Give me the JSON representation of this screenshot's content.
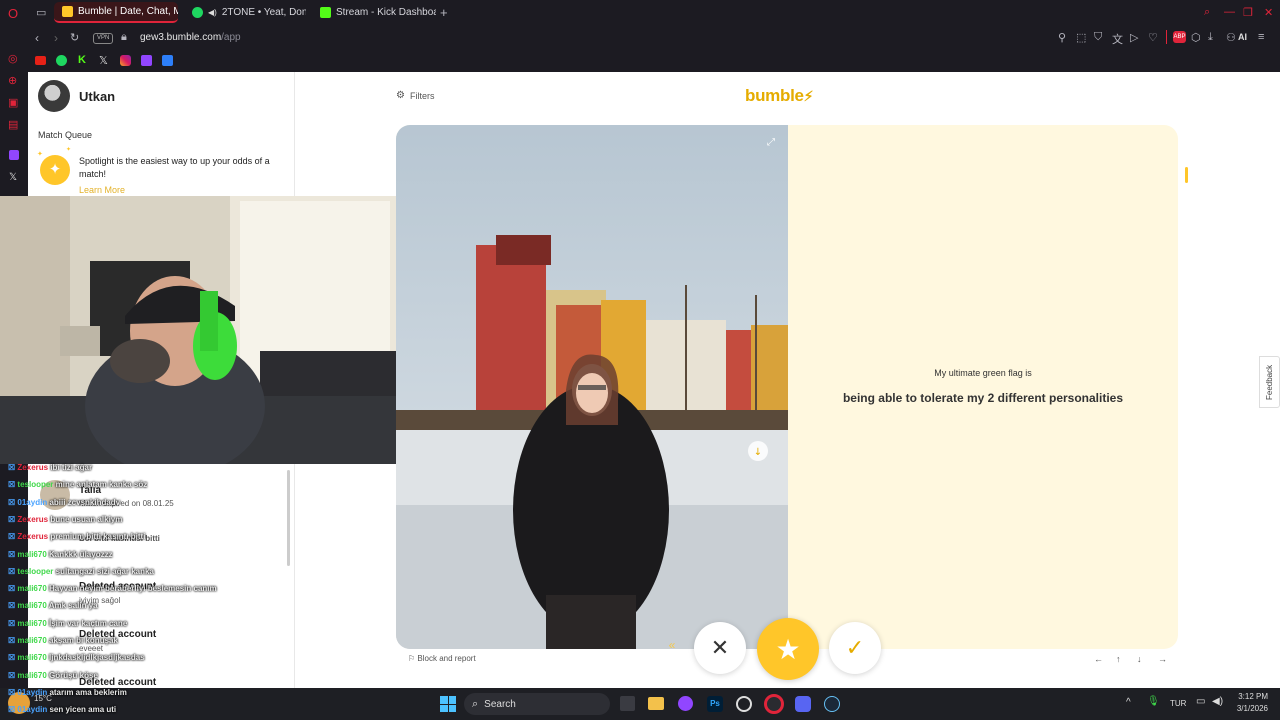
{
  "browser": {
    "tabs": [
      {
        "label": "Bumble | Date, Chat, Meet",
        "color": "#ffc629"
      },
      {
        "label": "2TONE • Yeat, Don To",
        "color": "#1ed760"
      },
      {
        "label": "Stream - Kick Dashboard",
        "color": "#53fc18"
      }
    ],
    "add_tab": "+",
    "vpn_badge": "VPN",
    "url_domain": "gew3.bumble.com",
    "url_path": "/app",
    "ai_label": "AI"
  },
  "profile": {
    "name": "Utkan"
  },
  "match_queue": {
    "heading": "Match Queue",
    "spotlight_text": "Spotlight is the easiest way to up your odds of a match!",
    "learn_more": "Learn More"
  },
  "conversations": [
    {
      "name": "Talia",
      "sub": "Match expired on 08.01.25"
    },
    {
      "name": "",
      "sub": "Bol bitti kasıntısı bitti"
    },
    {
      "name": "Deleted account",
      "sub": "iyiyim sağol"
    },
    {
      "name": "Deleted account",
      "sub": "eveeet"
    },
    {
      "name": "Deleted account",
      "sub": ""
    }
  ],
  "chat": [
    {
      "user": "Zexerus",
      "msg": "ibi tizi ağar",
      "color": "#e0243a"
    },
    {
      "user": "teslooper",
      "msg": "mine anlatam kanka söz",
      "color": "#3fd84a"
    },
    {
      "user": "01aydin",
      "msg": "abiii zcvsnkihdadv",
      "color": "#4aa3ff"
    },
    {
      "user": "Zexerus",
      "msg": "bune usuan alkiym",
      "color": "#e0243a"
    },
    {
      "user": "Zexerus",
      "msg": "premium bitti kasıntı bitti",
      "color": "#e0243a"
    },
    {
      "user": "mali670",
      "msg": "Kankkk ülayozzz",
      "color": "#3fd84a"
    },
    {
      "user": "teslooper",
      "msg": "sultangazi sizi ağar kanka",
      "color": "#3fd84a"
    },
    {
      "user": "mali670",
      "msg": "Hayvan neyim beraberliyı beslemesin canım",
      "color": "#3fd84a"
    },
    {
      "user": "mali670",
      "msg": "Amk salin ya",
      "color": "#3fd84a"
    },
    {
      "user": "mali670",
      "msg": "İşim var kaçtım cane",
      "color": "#3fd84a"
    },
    {
      "user": "mali670",
      "msg": "akşam bi konuşak",
      "color": "#3fd84a"
    },
    {
      "user": "mali670",
      "msg": "ljnkdaskljdlkjasdljkasdas",
      "color": "#3fd84a"
    },
    {
      "user": "mali670",
      "msg": "Görüşü köşe",
      "color": "#3fd84a"
    },
    {
      "user": "01aydin",
      "msg": "atarım ama beklerim",
      "color": "#4aa3ff"
    },
    {
      "user": "01aydin",
      "msg": "sen yicen ama uti",
      "color": "#4aa3ff"
    }
  ],
  "header": {
    "filters_label": "Filters",
    "logo_text": "bumble"
  },
  "card": {
    "prompt_title": "My ultimate green flag is",
    "prompt_answer": "being able to tolerate my 2 different personalities"
  },
  "actions": {
    "block_report": "Block and report",
    "backtrack_icon": "«",
    "pass_icon": "✕",
    "superswipe_icon": "★",
    "like_icon": "✓",
    "keys": [
      "←",
      "↑",
      "↓",
      "→"
    ]
  },
  "feedback_label": "Feedback",
  "taskbar": {
    "search_label": "Search",
    "weather_temp": "15°C",
    "language": "TUR",
    "time": "3:12 PM",
    "date": "3/1/2026"
  }
}
